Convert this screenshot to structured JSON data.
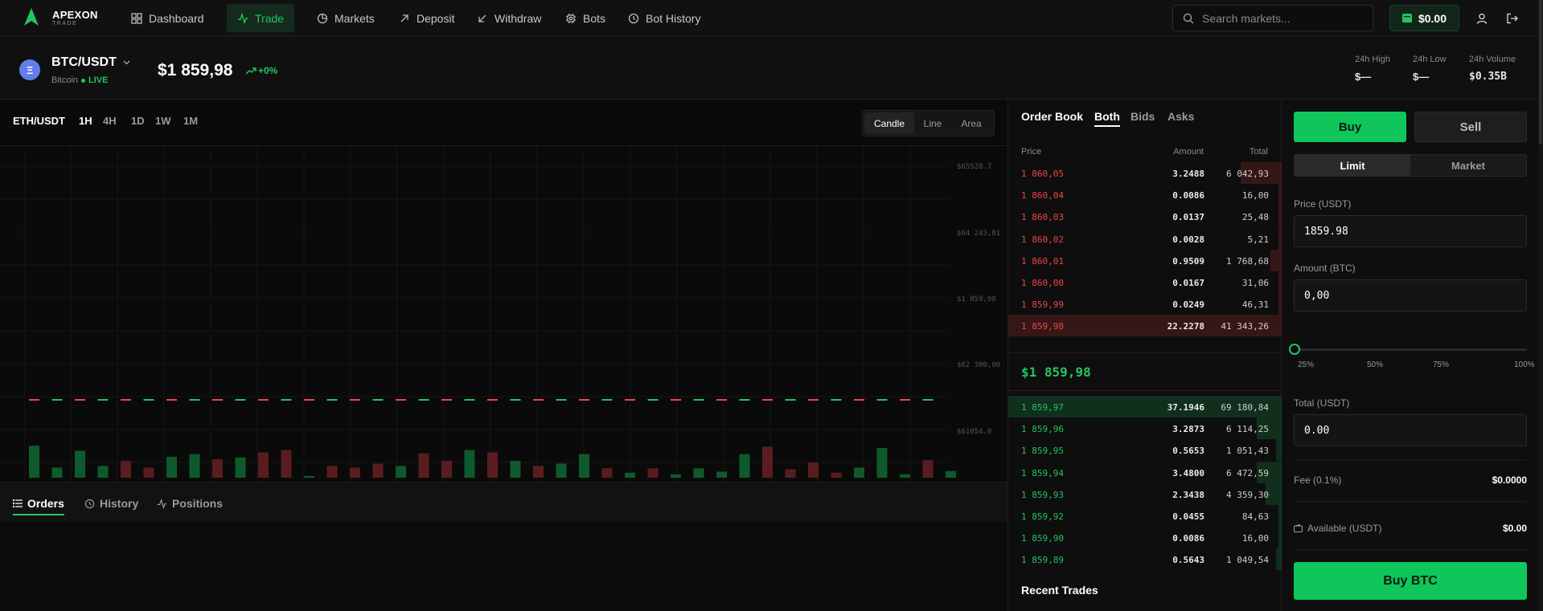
{
  "app": {
    "brand": "APEXON",
    "brand_sub": "TRADE"
  },
  "nav": {
    "items": [
      {
        "label": "Dashboard",
        "icon": "grid-icon"
      },
      {
        "label": "Trade",
        "icon": "activity-icon",
        "active": true
      },
      {
        "label": "Markets",
        "icon": "pie-chart-icon"
      },
      {
        "label": "Deposit",
        "icon": "arrow-up-right-icon"
      },
      {
        "label": "Withdraw",
        "icon": "arrow-down-left-icon"
      },
      {
        "label": "Bots",
        "icon": "cpu-icon"
      },
      {
        "label": "Bot History",
        "icon": "clock-icon"
      }
    ],
    "search_placeholder": "Search markets...",
    "wallet_balance": "$0.00"
  },
  "ticker": {
    "pair": "BTC/USDT",
    "name": "Bitcoin",
    "status": "LIVE",
    "price": "$1 859,98",
    "change": "+0%",
    "stats": [
      {
        "label": "24h High",
        "value": "$—"
      },
      {
        "label": "24h Low",
        "value": "$—"
      },
      {
        "label": "24h Volume",
        "value": "$0.35B"
      }
    ]
  },
  "chart": {
    "pair": "ETH/USDT",
    "timeframes": [
      "1H",
      "4H",
      "1D",
      "1W",
      "1M"
    ],
    "active_timeframe": "1H",
    "types": [
      "Candle",
      "Line",
      "Area"
    ],
    "active_type": "Candle",
    "y_labels": [
      "$65528.7",
      "$64 243,81",
      "$1 859,98",
      "$62 300,00",
      "$61054.0"
    ],
    "volumes": [
      {
        "v": 0.95,
        "c": "g"
      },
      {
        "v": 0.3,
        "c": "g"
      },
      {
        "v": 0.8,
        "c": "g"
      },
      {
        "v": 0.35,
        "c": "g"
      },
      {
        "v": 0.5,
        "c": "r"
      },
      {
        "v": 0.3,
        "c": "r"
      },
      {
        "v": 0.62,
        "c": "g"
      },
      {
        "v": 0.7,
        "c": "g"
      },
      {
        "v": 0.55,
        "c": "r"
      },
      {
        "v": 0.6,
        "c": "g"
      },
      {
        "v": 0.75,
        "c": "r"
      },
      {
        "v": 0.82,
        "c": "r"
      },
      {
        "v": 0.05,
        "c": "g"
      },
      {
        "v": 0.35,
        "c": "r"
      },
      {
        "v": 0.3,
        "c": "r"
      },
      {
        "v": 0.42,
        "c": "r"
      },
      {
        "v": 0.35,
        "c": "g"
      },
      {
        "v": 0.72,
        "c": "r"
      },
      {
        "v": 0.5,
        "c": "r"
      },
      {
        "v": 0.82,
        "c": "g"
      },
      {
        "v": 0.75,
        "c": "r"
      },
      {
        "v": 0.5,
        "c": "g"
      },
      {
        "v": 0.35,
        "c": "r"
      },
      {
        "v": 0.42,
        "c": "g"
      },
      {
        "v": 0.7,
        "c": "g"
      },
      {
        "v": 0.28,
        "c": "r"
      },
      {
        "v": 0.15,
        "c": "g"
      },
      {
        "v": 0.28,
        "c": "r"
      },
      {
        "v": 0.1,
        "c": "g"
      },
      {
        "v": 0.28,
        "c": "g"
      },
      {
        "v": 0.18,
        "c": "g"
      },
      {
        "v": 0.7,
        "c": "g"
      },
      {
        "v": 0.92,
        "c": "r"
      },
      {
        "v": 0.25,
        "c": "r"
      },
      {
        "v": 0.45,
        "c": "r"
      },
      {
        "v": 0.15,
        "c": "r"
      },
      {
        "v": 0.3,
        "c": "g"
      },
      {
        "v": 0.88,
        "c": "g"
      },
      {
        "v": 0.1,
        "c": "g"
      },
      {
        "v": 0.52,
        "c": "r"
      },
      {
        "v": 0.2,
        "c": "g"
      }
    ]
  },
  "bottom_tabs": [
    {
      "label": "Orders",
      "icon": "list-icon",
      "active": true
    },
    {
      "label": "History",
      "icon": "clock-icon"
    },
    {
      "label": "Positions",
      "icon": "activity-icon"
    }
  ],
  "orderbook": {
    "title": "Order Book",
    "tabs": [
      "Both",
      "Bids",
      "Asks"
    ],
    "active_tab": "Both",
    "headers": {
      "price": "Price",
      "amount": "Amount",
      "total": "Total"
    },
    "asks": [
      {
        "price": "1 860,05",
        "amount": "3.2488",
        "total": "6 042,93",
        "depth": 0.15
      },
      {
        "price": "1 860,04",
        "amount": "0.0086",
        "total": "16,00",
        "depth": 0.01
      },
      {
        "price": "1 860,03",
        "amount": "0.0137",
        "total": "25,48",
        "depth": 0.01
      },
      {
        "price": "1 860,02",
        "amount": "0.0028",
        "total": "5,21",
        "depth": 0.005
      },
      {
        "price": "1 860,01",
        "amount": "0.9509",
        "total": "1 768,68",
        "depth": 0.04
      },
      {
        "price": "1 860,00",
        "amount": "0.0167",
        "total": "31,06",
        "depth": 0.01
      },
      {
        "price": "1 859,99",
        "amount": "0.0249",
        "total": "46,31",
        "depth": 0.01
      },
      {
        "price": "1 859,98",
        "amount": "22.2278",
        "total": "41 343,26",
        "depth": 1.0
      }
    ],
    "mid_price": "$1 859,98",
    "bids": [
      {
        "price": "1 859,97",
        "amount": "37.1946",
        "total": "69 180,84",
        "depth": 1.0
      },
      {
        "price": "1 859,96",
        "amount": "3.2873",
        "total": "6 114,25",
        "depth": 0.09
      },
      {
        "price": "1 859,95",
        "amount": "0.5653",
        "total": "1 051,43",
        "depth": 0.02
      },
      {
        "price": "1 859,94",
        "amount": "3.4800",
        "total": "6 472,59",
        "depth": 0.09
      },
      {
        "price": "1 859,93",
        "amount": "2.3438",
        "total": "4 359,30",
        "depth": 0.06
      },
      {
        "price": "1 859,92",
        "amount": "0.0455",
        "total": "84,63",
        "depth": 0.01
      },
      {
        "price": "1 859,90",
        "amount": "0.0086",
        "total": "16,00",
        "depth": 0.005
      },
      {
        "price": "1 859,89",
        "amount": "0.5643",
        "total": "1 049,54",
        "depth": 0.02
      }
    ],
    "recent_trades_title": "Recent Trades"
  },
  "trade": {
    "buy": "Buy",
    "sell": "Sell",
    "order_types": [
      "Limit",
      "Market"
    ],
    "active_type": "Limit",
    "price_label": "Price (USDT)",
    "price_value": "1859.98",
    "amount_label": "Amount (BTC)",
    "amount_value": "0,00",
    "slider_value": 0,
    "percents": [
      "25%",
      "50%",
      "75%",
      "100%"
    ],
    "total_label": "Total (USDT)",
    "total_value": "0.00",
    "fee_label": "Fee (0.1%)",
    "fee_value": "$0.0000",
    "available_label": "Available (USDT)",
    "available_value": "$0.00",
    "submit": "Buy BTC"
  },
  "colors": {
    "accent": "#22c55e",
    "ask": "#ef4444",
    "bid": "#22c55e"
  }
}
